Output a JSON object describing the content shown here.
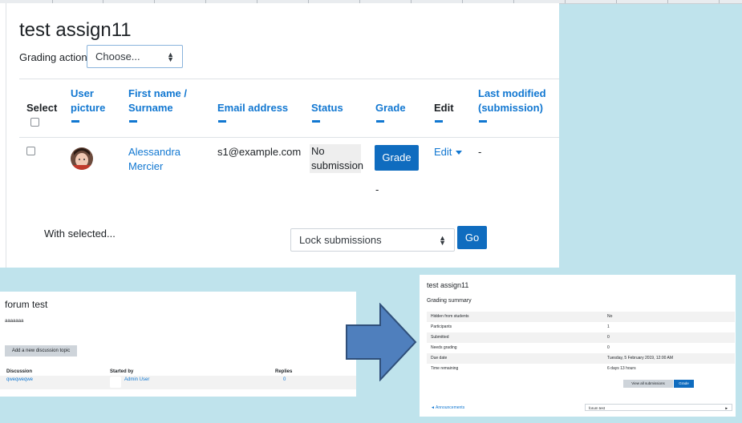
{
  "assignment": {
    "title": "test assign11",
    "grading_action_label": "Grading action",
    "grading_action_value": "Choose..."
  },
  "table": {
    "headers": {
      "select": "Select",
      "user_picture_1": "User",
      "user_picture_2": "picture",
      "name_1": "First name /",
      "name_2": "Surname",
      "email": "Email address",
      "status": "Status",
      "grade": "Grade",
      "edit": "Edit",
      "modified_1": "Last modified",
      "modified_2": "(submission)"
    },
    "row": {
      "first_name": "Alessandra",
      "surname": "Mercier",
      "email": "s1@example.com",
      "status_1": "No",
      "status_2": "submission",
      "grade_button": "Grade",
      "grade_value": "-",
      "edit_label": "Edit",
      "last_modified": "-"
    }
  },
  "bulk": {
    "label": "With selected...",
    "option": "Lock submissions",
    "go": "Go"
  },
  "forum": {
    "title": "forum test",
    "description": "aaaaaaa",
    "add_button": "Add a new discussion topic",
    "headers": {
      "discussion": "Discussion",
      "started_by": "Started by",
      "replies": "Replies"
    },
    "row": {
      "discussion": "qweqweqwe",
      "started_by": "Admin User",
      "replies": "0"
    }
  },
  "summary": {
    "title": "test assign11",
    "heading": "Grading summary",
    "rows": [
      {
        "k": "Hidden from students",
        "v": "No"
      },
      {
        "k": "Participants",
        "v": "1"
      },
      {
        "k": "Submitted",
        "v": "0"
      },
      {
        "k": "Needs grading",
        "v": "0"
      },
      {
        "k": "Due date",
        "v": "Tuesday, 5 February 2019, 12:00 AM"
      },
      {
        "k": "Time remaining",
        "v": "6 days 13 hours"
      }
    ],
    "view_all": "View all submissions",
    "grade": "Grade",
    "prev_link": "◄ Announcements",
    "jump_value": "forum test"
  },
  "colors": {
    "link": "#1177d1",
    "primary": "#0f6cbf",
    "arrow": "#4f7fbd",
    "backdrop": "#bfe3ec"
  }
}
